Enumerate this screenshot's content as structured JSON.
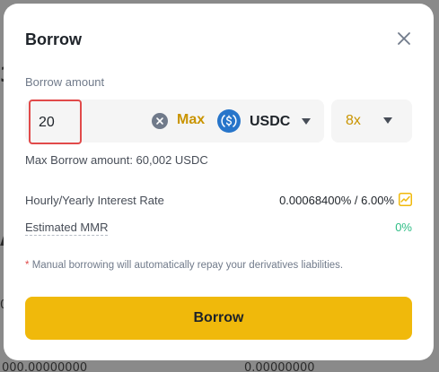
{
  "background": {
    "fragments": [
      "3",
      "A",
      "0",
      "000.00000000",
      "0.00000000"
    ]
  },
  "modal": {
    "title": "Borrow",
    "close_icon": "close-icon"
  },
  "borrow_amount": {
    "label": "Borrow amount",
    "value": "20",
    "clear_icon": "clear-icon",
    "max_label": "Max",
    "coin": "USDC",
    "coin_icon": "usdc-icon"
  },
  "leverage": {
    "value": "8x"
  },
  "max_borrow": {
    "text": "Max Borrow amount: 60,002 USDC"
  },
  "info": {
    "interest_label": "Hourly/Yearly Interest Rate",
    "interest_value": "0.00068400% / 6.00%",
    "mmr_label": "Estimated MMR",
    "mmr_value": "0%"
  },
  "note": {
    "star": "*",
    "text": "Manual borrowing will automatically repay your derivatives liabilities."
  },
  "submit": {
    "label": "Borrow"
  },
  "colors": {
    "accent": "#f0b90b",
    "max_text": "#c99400",
    "positive": "#2ebd85",
    "highlight_border": "#e14a4a"
  }
}
